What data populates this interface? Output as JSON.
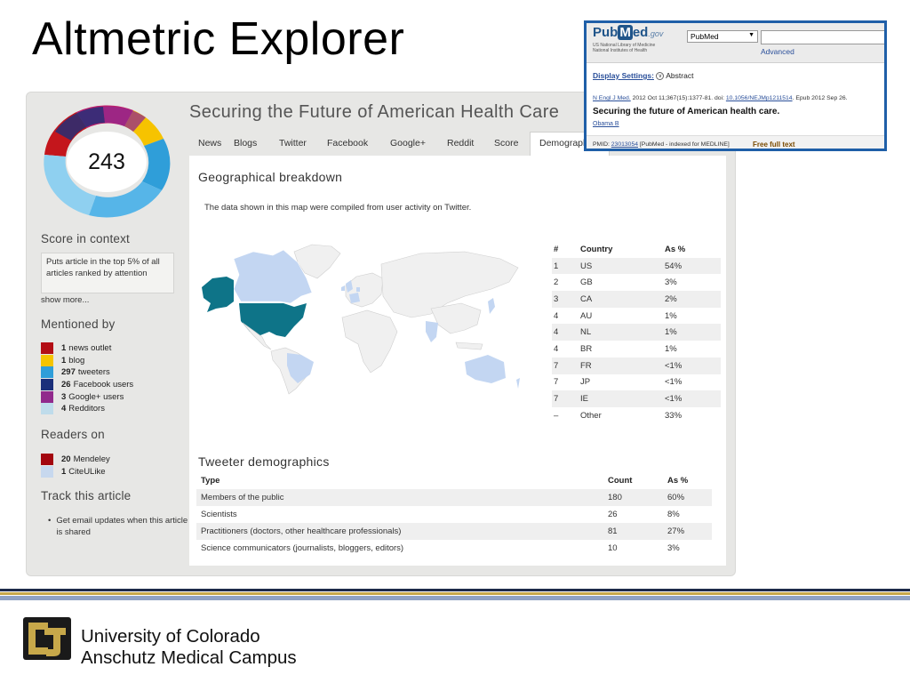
{
  "slide": {
    "title": "Altmetric Explorer",
    "footer": {
      "line1": "University of Colorado",
      "line2": "Anschutz Medical Campus"
    }
  },
  "colors": {
    "highlight_country": "#0e7488",
    "light_country": "#c3d6f2",
    "base_country": "#f0f0f0",
    "footer_gold": "#c7a84a",
    "pubmed_border": "#1f5fa8"
  },
  "altmetric": {
    "score": "243",
    "article_title": "Securing the Future of American Health Care",
    "tabs": [
      {
        "label": "News"
      },
      {
        "label": "Blogs"
      },
      {
        "label": "Twitter"
      },
      {
        "label": "Facebook"
      },
      {
        "label": "Google+"
      },
      {
        "label": "Reddit"
      },
      {
        "label": "Score"
      },
      {
        "label": "Demographics"
      }
    ],
    "score_context": {
      "heading": "Score in context",
      "text": "Puts article in the top 5% of all articles ranked by attention",
      "show_more": "show more..."
    },
    "mentioned_by": {
      "heading": "Mentioned by",
      "items": [
        {
          "count": "1",
          "label": "news outlet",
          "color": "#b30e15"
        },
        {
          "count": "1",
          "label": "blog",
          "color": "#f5c400"
        },
        {
          "count": "297",
          "label": "tweeters",
          "color": "#2f9ed9"
        },
        {
          "count": "26",
          "label": "Facebook users",
          "color": "#1b2f7a"
        },
        {
          "count": "3",
          "label": "Google+ users",
          "color": "#912a8c"
        },
        {
          "count": "4",
          "label": "Redditors",
          "color": "#bfdceb"
        }
      ]
    },
    "readers_on": {
      "heading": "Readers on",
      "items": [
        {
          "count": "20",
          "label": "Mendeley",
          "color": "#a3060f"
        },
        {
          "count": "1",
          "label": "CiteULike",
          "color": "#c7d8ee"
        }
      ]
    },
    "track": {
      "heading": "Track this article",
      "bullet": "Get email updates when this article is shared"
    },
    "geo": {
      "heading": "Geographical breakdown",
      "note": "The data shown in this map were compiled from user activity on Twitter.",
      "columns": {
        "rank": "#",
        "country": "Country",
        "pct": "As %"
      },
      "rows": [
        {
          "rank": "1",
          "country": "US",
          "pct": "54%"
        },
        {
          "rank": "2",
          "country": "GB",
          "pct": "3%"
        },
        {
          "rank": "3",
          "country": "CA",
          "pct": "2%"
        },
        {
          "rank": "4",
          "country": "AU",
          "pct": "1%"
        },
        {
          "rank": "4",
          "country": "NL",
          "pct": "1%"
        },
        {
          "rank": "4",
          "country": "BR",
          "pct": "1%"
        },
        {
          "rank": "7",
          "country": "FR",
          "pct": "<1%"
        },
        {
          "rank": "7",
          "country": "JP",
          "pct": "<1%"
        },
        {
          "rank": "7",
          "country": "IE",
          "pct": "<1%"
        },
        {
          "rank": "–",
          "country": "Other",
          "pct": "33%"
        }
      ]
    },
    "tweeter_demographics": {
      "heading": "Tweeter demographics",
      "columns": {
        "type": "Type",
        "count": "Count",
        "pct": "As %"
      },
      "rows": [
        {
          "type": "Members of the public",
          "count": "180",
          "pct": "60%"
        },
        {
          "type": "Scientists",
          "count": "26",
          "pct": "8%"
        },
        {
          "type": "Practitioners (doctors, other healthcare professionals)",
          "count": "81",
          "pct": "27%"
        },
        {
          "type": "Science communicators (journalists, bloggers, editors)",
          "count": "10",
          "pct": "3%"
        }
      ]
    }
  },
  "pubmed": {
    "logo_left": "Pub",
    "logo_m": "M",
    "logo_right": "ed",
    "logo_gov": ".gov",
    "org_line1": "US National Library of Medicine",
    "org_line2": "National Institutes of Health",
    "db_select": "PubMed",
    "advanced": "Advanced",
    "display_settings": "Display Settings:",
    "display_value": "Abstract",
    "journal": "N Engl J Med.",
    "citation": "2012 Oct 11;367(15):1377-81. doi:",
    "doi": "10.1056/NEJMp1211514",
    "epub": ". Epub 2012 Sep 26.",
    "title": "Securing the future of American health care.",
    "author": "Obama B",
    "pmid_label": "PMID:",
    "pmid": "23013054",
    "pmid_note": "[PubMed - indexed for MEDLINE]",
    "free_text": "Free full text"
  }
}
